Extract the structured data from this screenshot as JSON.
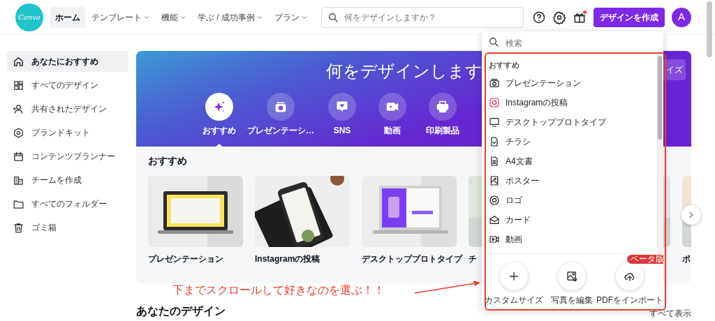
{
  "logo": {
    "text": "Canva"
  },
  "nav": [
    {
      "label": "ホーム",
      "selected": true,
      "dropdown": false
    },
    {
      "label": "テンプレート",
      "selected": false,
      "dropdown": true
    },
    {
      "label": "機能",
      "selected": false,
      "dropdown": true
    },
    {
      "label": "学ぶ / 成功事例",
      "selected": false,
      "dropdown": true
    },
    {
      "label": "プラン",
      "selected": false,
      "dropdown": true
    }
  ],
  "search": {
    "placeholder": "何をデザインしますか？"
  },
  "gift": {
    "has_notification": true
  },
  "create_button": "デザインを作成",
  "avatar": "A",
  "sidebar": {
    "items": [
      {
        "label": "あなたにおすすめ",
        "selected": true
      },
      {
        "label": "すべてのデザイン",
        "selected": false
      },
      {
        "label": "共有されたデザイン",
        "selected": false
      },
      {
        "label": "ブランドキット",
        "selected": false
      },
      {
        "label": "コンテンツプランナー",
        "selected": false
      },
      {
        "label": "チームを作成",
        "selected": false
      },
      {
        "label": "すべてのフォルダー",
        "selected": false
      },
      {
        "label": "ゴミ箱",
        "selected": false
      }
    ]
  },
  "banner": {
    "title": "何をデザインします",
    "custom_size_button": "イズ",
    "categories": [
      {
        "label": "おすすめ",
        "selected": true
      },
      {
        "label": "プレゼンテーシ…",
        "selected": false
      },
      {
        "label": "SNS",
        "selected": false
      },
      {
        "label": "動画",
        "selected": false
      },
      {
        "label": "印刷製品",
        "selected": false
      }
    ]
  },
  "recommended": {
    "heading": "おすすめ",
    "templates": [
      {
        "label": "プレゼンテーション"
      },
      {
        "label": "Instagramの投稿"
      },
      {
        "label": "デスクトッププロトタイプ"
      },
      {
        "label": "チ"
      },
      {
        "label": "ポ"
      }
    ]
  },
  "your_designs": {
    "heading": "あなたのデザイン",
    "see_all": "すべて表示"
  },
  "create_menu": {
    "search_placeholder": "検索",
    "section": "おすすめ",
    "items": [
      {
        "label": "プレゼンテーション"
      },
      {
        "label": "Instagramの投稿"
      },
      {
        "label": "デスクトッププロトタイプ"
      },
      {
        "label": "チラシ"
      },
      {
        "label": "A4文書"
      },
      {
        "label": "ポスター"
      },
      {
        "label": "ロゴ"
      },
      {
        "label": "カード"
      },
      {
        "label": "動画"
      }
    ],
    "actions": [
      {
        "label": "カスタムサイズ"
      },
      {
        "label": "写真を編集"
      },
      {
        "label": "PDFをインポート",
        "badge": "ベータ版"
      }
    ]
  },
  "annotation": {
    "text": "下までスクロールして好きなのを選ぶ！！"
  }
}
